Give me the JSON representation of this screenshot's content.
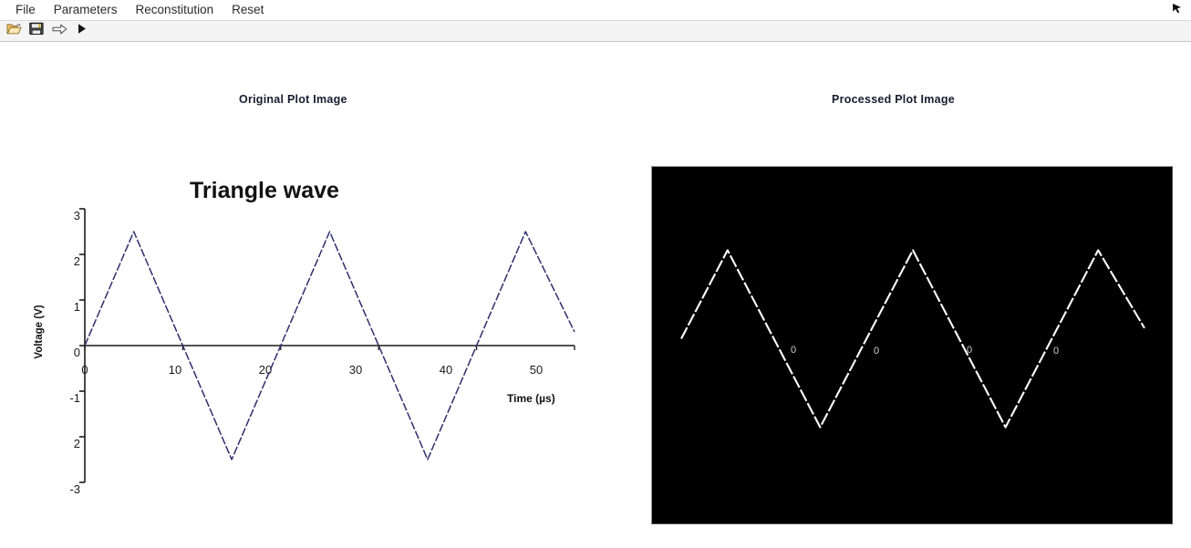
{
  "window": {
    "corner_icon": "cursor-arrow-icon"
  },
  "menubar": {
    "items": [
      {
        "label": "File",
        "name": "menu-file"
      },
      {
        "label": "Parameters",
        "name": "menu-parameters"
      },
      {
        "label": "Reconstitution",
        "name": "menu-reconstitution"
      },
      {
        "label": "Reset",
        "name": "menu-reset"
      }
    ]
  },
  "toolbar": {
    "buttons": [
      {
        "icon": "open-folder-icon",
        "name": "toolbar-open"
      },
      {
        "icon": "save-floppy-icon",
        "name": "toolbar-save"
      },
      {
        "icon": "arrow-right-icon",
        "name": "toolbar-process"
      },
      {
        "icon": "play-icon",
        "name": "toolbar-run"
      }
    ]
  },
  "panels": {
    "left_title": "Original Plot Image",
    "right_title": "Processed Plot Image"
  },
  "colors": {
    "trace": "#2e2e6e",
    "axis": "#1a1a1a",
    "processed_background": "#000000",
    "processed_trace": "#ffffff",
    "title_text": "#1b1b30"
  },
  "chart_data": {
    "type": "line",
    "title": "Triangle wave",
    "xlabel": "Time (µs)",
    "ylabel": "Voltage (V)",
    "xlim": [
      0,
      50
    ],
    "ylim": [
      -3,
      3
    ],
    "xticks": [
      "0",
      "10",
      "20",
      "30",
      "40",
      "50"
    ],
    "xtick_values": [
      0,
      10,
      20,
      30,
      40,
      50
    ],
    "yticks": [
      "3",
      "2",
      "1",
      "0",
      "-1",
      "2",
      "-3"
    ],
    "ytick_values": [
      3,
      2,
      1,
      0,
      -1,
      -2,
      -3
    ],
    "grid": false,
    "legend": false,
    "series": [
      {
        "name": "Triangle wave",
        "period_us": 20,
        "amplitude_v": 2.5,
        "x": [
          0,
          5,
          10,
          15,
          20,
          25,
          30,
          35,
          40,
          45,
          50
        ],
        "y": [
          0,
          2.5,
          0,
          -2.5,
          0,
          2.5,
          0,
          -2.5,
          0,
          2.5,
          0.3
        ]
      }
    ]
  },
  "processed": {
    "description": "binarized white trace on black background",
    "residual_digits": [
      "0",
      "0",
      "0",
      "0"
    ]
  }
}
